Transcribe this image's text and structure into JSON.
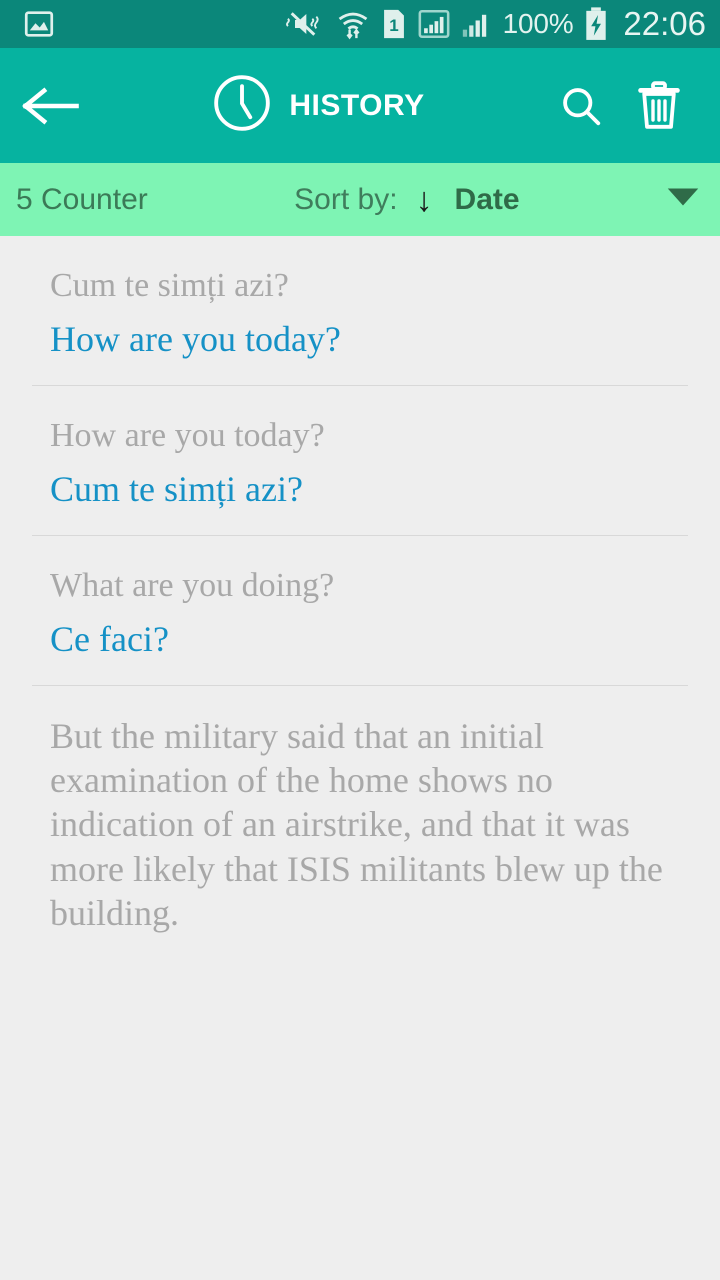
{
  "status_bar": {
    "icons": [
      "gallery-image-icon",
      "vibrate-mute-icon",
      "wifi-transfer-icon",
      "sim-one-icon",
      "signal-boxed-icon",
      "signal-bars-icon"
    ],
    "sim_label": "1",
    "battery_percent": "100%",
    "battery_state": "charging",
    "time": "22:06",
    "background": "#0b877a"
  },
  "app_bar": {
    "back_label": "back-arrow",
    "clock_icon": "clock-icon",
    "title": "HISTORY",
    "search_label": "search-icon",
    "delete_label": "trash-icon",
    "background": "#06b3a0"
  },
  "sort_bar": {
    "counter": "5 Counter",
    "sort_label": "Sort by:",
    "direction_arrow": "↓",
    "sort_value": "Date",
    "caret": "▼",
    "background": "#7ef4b4"
  },
  "colors": {
    "source_text": "#a8a8a8",
    "target_text": "#1591c6",
    "page_background": "#eeeeee",
    "divider": "#d8d8d8"
  },
  "history": {
    "items": [
      {
        "source": "Cum te simți azi?",
        "target": "How are you today?",
        "has_divider": true,
        "is_paragraph": false
      },
      {
        "source": "How are you today?",
        "target": "Cum te simți azi?",
        "has_divider": true,
        "is_paragraph": false
      },
      {
        "source": "What are you doing?",
        "target": "Ce faci?",
        "has_divider": true,
        "is_paragraph": false
      },
      {
        "source": "But the military said that an initial examination of the home shows no indication of an airstrike, and that it was more likely that ISIS militants blew up the building.",
        "target": "",
        "has_divider": false,
        "is_paragraph": true
      }
    ]
  }
}
